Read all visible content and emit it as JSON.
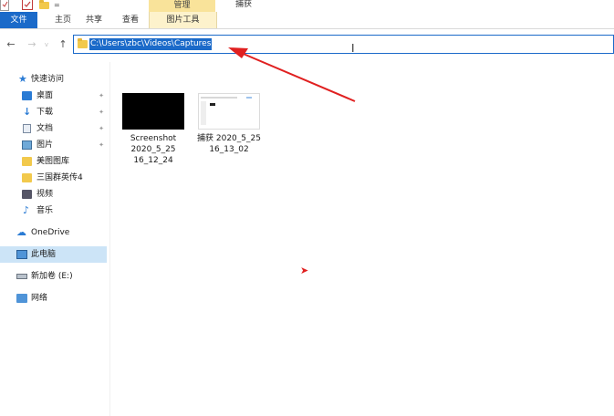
{
  "titlebar": {
    "manage_label": "管理",
    "window_title": "捕获",
    "qat_dropdown": "="
  },
  "ribbon": {
    "tabs": [
      {
        "label": "文件"
      },
      {
        "label": "主页"
      },
      {
        "label": "共享"
      },
      {
        "label": "查看"
      },
      {
        "label": "图片工具"
      }
    ]
  },
  "address": {
    "path": "C:\\Users\\zbc\\Videos\\Captures",
    "selected": true
  },
  "nav_buttons": {
    "back": "←",
    "forward": "→",
    "recent": "v",
    "up": "↑"
  },
  "sidebar": {
    "items": [
      {
        "label": "快速访问",
        "icon": "star-icon"
      },
      {
        "label": "桌面",
        "icon": "desktop-icon",
        "pinned": true
      },
      {
        "label": "下载",
        "icon": "download-icon",
        "pinned": true
      },
      {
        "label": "文档",
        "icon": "document-icon",
        "pinned": true
      },
      {
        "label": "图片",
        "icon": "picture-icon",
        "pinned": true
      },
      {
        "label": "美图图库",
        "icon": "folder-icon"
      },
      {
        "label": "三国群英传4",
        "icon": "folder-icon"
      },
      {
        "label": "视频",
        "icon": "video-icon"
      },
      {
        "label": "音乐",
        "icon": "music-icon"
      },
      {
        "label": "OneDrive",
        "icon": "cloud-icon"
      },
      {
        "label": "此电脑",
        "icon": "computer-icon",
        "selected": true
      },
      {
        "label": "新加卷 (E:)",
        "icon": "drive-icon"
      },
      {
        "label": "网络",
        "icon": "network-icon"
      }
    ]
  },
  "files": [
    {
      "name": "Screenshot\n2020_5_25\n16_12_24",
      "thumb": "black"
    },
    {
      "name": "捕获 2020_5_25\n16_13_02",
      "thumb": "screenshot"
    }
  ],
  "colors": {
    "accent": "#1b6ac9",
    "manage_tab": "#f9e39a",
    "selection": "#cce4f7",
    "annotation": "#e02020"
  }
}
